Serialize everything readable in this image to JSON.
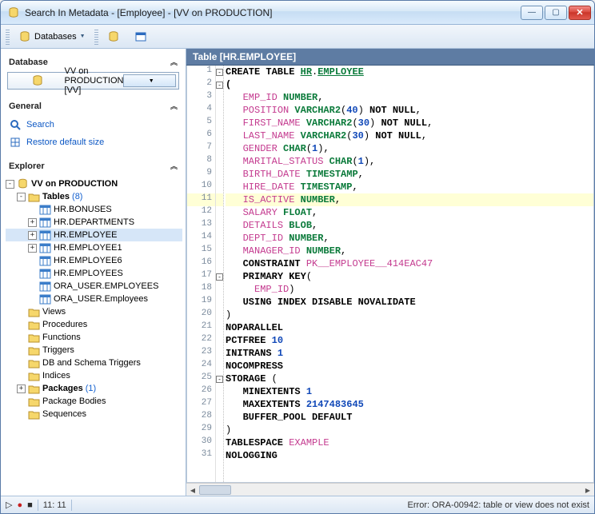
{
  "window": {
    "title": "Search In Metadata - [Employee] - [VV on PRODUCTION]"
  },
  "toolbar": {
    "databases_label": "Databases"
  },
  "sidebar": {
    "database_hdr": "Database",
    "db_selected": "VV on PRODUCTION [VV]",
    "general_hdr": "General",
    "search_label": "Search",
    "restore_label": "Restore default size",
    "explorer_hdr": "Explorer",
    "root": "VV on PRODUCTION",
    "tables_label": "Tables",
    "tables_count": "(8)",
    "tables": [
      "HR.BONUSES",
      "HR.DEPARTMENTS",
      "HR.EMPLOYEE",
      "HR.EMPLOYEE1",
      "HR.EMPLOYEE6",
      "HR.EMPLOYEES",
      "ORA_USER.EMPLOYEES",
      "ORA_USER.Employees"
    ],
    "nodes": [
      "Views",
      "Procedures",
      "Functions",
      "Triggers",
      "DB and Schema Triggers",
      "Indices"
    ],
    "packages_label": "Packages",
    "packages_count": "(1)",
    "nodes2": [
      "Package Bodies",
      "Sequences"
    ]
  },
  "code_header": "Table [HR.EMPLOYEE]",
  "highlight_line": 11,
  "code_lines": [
    {
      "n": 1,
      "fold": "-",
      "html": "<span class='kw'>CREATE TABLE</span> <span class='lnk'>HR</span>.<span class='lnk'>EMPLOYEE</span>"
    },
    {
      "n": 2,
      "fold": "-",
      "html": "<span class='kw'>(</span>"
    },
    {
      "n": 3,
      "html": "   <span class='id'>EMP_ID</span> <span class='ty'>NUMBER</span>,"
    },
    {
      "n": 4,
      "html": "   <span class='id'>POSITION</span> <span class='ty'>VARCHAR2</span>(<span class='num'>40</span>) <span class='kw'>NOT NULL</span>,"
    },
    {
      "n": 5,
      "html": "   <span class='id'>FIRST_NAME</span> <span class='ty'>VARCHAR2</span>(<span class='num'>30</span>) <span class='kw'>NOT NULL</span>,"
    },
    {
      "n": 6,
      "html": "   <span class='id'>LAST_NAME</span> <span class='ty'>VARCHAR2</span>(<span class='num'>30</span>) <span class='kw'>NOT NULL</span>,"
    },
    {
      "n": 7,
      "html": "   <span class='id'>GENDER</span> <span class='ty'>CHAR</span>(<span class='num'>1</span>),"
    },
    {
      "n": 8,
      "html": "   <span class='id'>MARITAL_STATUS</span> <span class='ty'>CHAR</span>(<span class='num'>1</span>),"
    },
    {
      "n": 9,
      "html": "   <span class='id'>BIRTH_DATE</span> <span class='ty'>TIMESTAMP</span>,"
    },
    {
      "n": 10,
      "html": "   <span class='id'>HIRE_DATE</span> <span class='ty'>TIMESTAMP</span>,"
    },
    {
      "n": 11,
      "html": "   <span class='id'>IS_ACTIVE</span> <span class='ty'>NUMBER</span>,"
    },
    {
      "n": 12,
      "html": "   <span class='id'>SALARY</span> <span class='ty'>FLOAT</span>,"
    },
    {
      "n": 13,
      "html": "   <span class='id'>DETAILS</span> <span class='ty'>BLOB</span>,"
    },
    {
      "n": 14,
      "html": "   <span class='id'>DEPT_ID</span> <span class='ty'>NUMBER</span>,"
    },
    {
      "n": 15,
      "html": "   <span class='id'>MANAGER_ID</span> <span class='ty'>NUMBER</span>,"
    },
    {
      "n": 16,
      "html": "   <span class='kw'>CONSTRAINT</span> <span class='id'>PK__EMPLOYEE__414EAC47</span>"
    },
    {
      "n": 17,
      "fold": "-",
      "html": "   <span class='kw'>PRIMARY KEY</span>("
    },
    {
      "n": 18,
      "html": "     <span class='id'>EMP_ID</span>)"
    },
    {
      "n": 19,
      "html": "   <span class='kw'>USING INDEX DISABLE NOVALIDATE</span>"
    },
    {
      "n": 20,
      "html": ")"
    },
    {
      "n": 21,
      "html": "<span class='kw'>NOPARALLEL</span>"
    },
    {
      "n": 22,
      "html": "<span class='kw'>PCTFREE</span> <span class='num'>10</span>"
    },
    {
      "n": 23,
      "html": "<span class='kw'>INITRANS</span> <span class='num'>1</span>"
    },
    {
      "n": 24,
      "html": "<span class='kw'>NOCOMPRESS</span>"
    },
    {
      "n": 25,
      "fold": "-",
      "html": "<span class='kw'>STORAGE</span> ("
    },
    {
      "n": 26,
      "html": "   <span class='kw'>MINEXTENTS</span> <span class='num'>1</span>"
    },
    {
      "n": 27,
      "html": "   <span class='kw'>MAXEXTENTS</span> <span class='num'>2147483645</span>"
    },
    {
      "n": 28,
      "html": "   <span class='kw'>BUFFER_POOL DEFAULT</span>"
    },
    {
      "n": 29,
      "html": ")"
    },
    {
      "n": 30,
      "html": "<span class='kw'>TABLESPACE</span> <span class='id'>EXAMPLE</span>"
    },
    {
      "n": 31,
      "html": "<span class='kw'>NOLOGGING</span>"
    }
  ],
  "status": {
    "cursor": "11:  11",
    "error": "Error: ORA-00942: table or view does not exist"
  }
}
